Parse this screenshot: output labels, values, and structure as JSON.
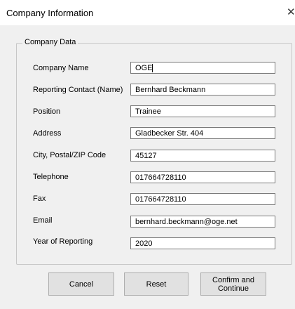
{
  "window": {
    "title": "Company Information",
    "close_glyph": "✕"
  },
  "group": {
    "label": "Company Data"
  },
  "fields": [
    {
      "label": "Company Name",
      "value": "OGE"
    },
    {
      "label": "Reporting Contact (Name)",
      "value": "Bernhard Beckmann"
    },
    {
      "label": "Position",
      "value": "Trainee"
    },
    {
      "label": "Address",
      "value": "Gladbecker Str. 404"
    },
    {
      "label": "City, Postal/ZIP Code",
      "value": "45127"
    },
    {
      "label": "Telephone",
      "value": "017664728110"
    },
    {
      "label": "Fax",
      "value": "017664728110"
    },
    {
      "label": "Email",
      "value": "bernhard.beckmann@oge.net"
    },
    {
      "label": "Year of Reporting",
      "value": "2020"
    }
  ],
  "buttons": {
    "cancel": "Cancel",
    "reset": "Reset",
    "confirm_line1": "Confirm and",
    "confirm_line2": "Continue"
  }
}
